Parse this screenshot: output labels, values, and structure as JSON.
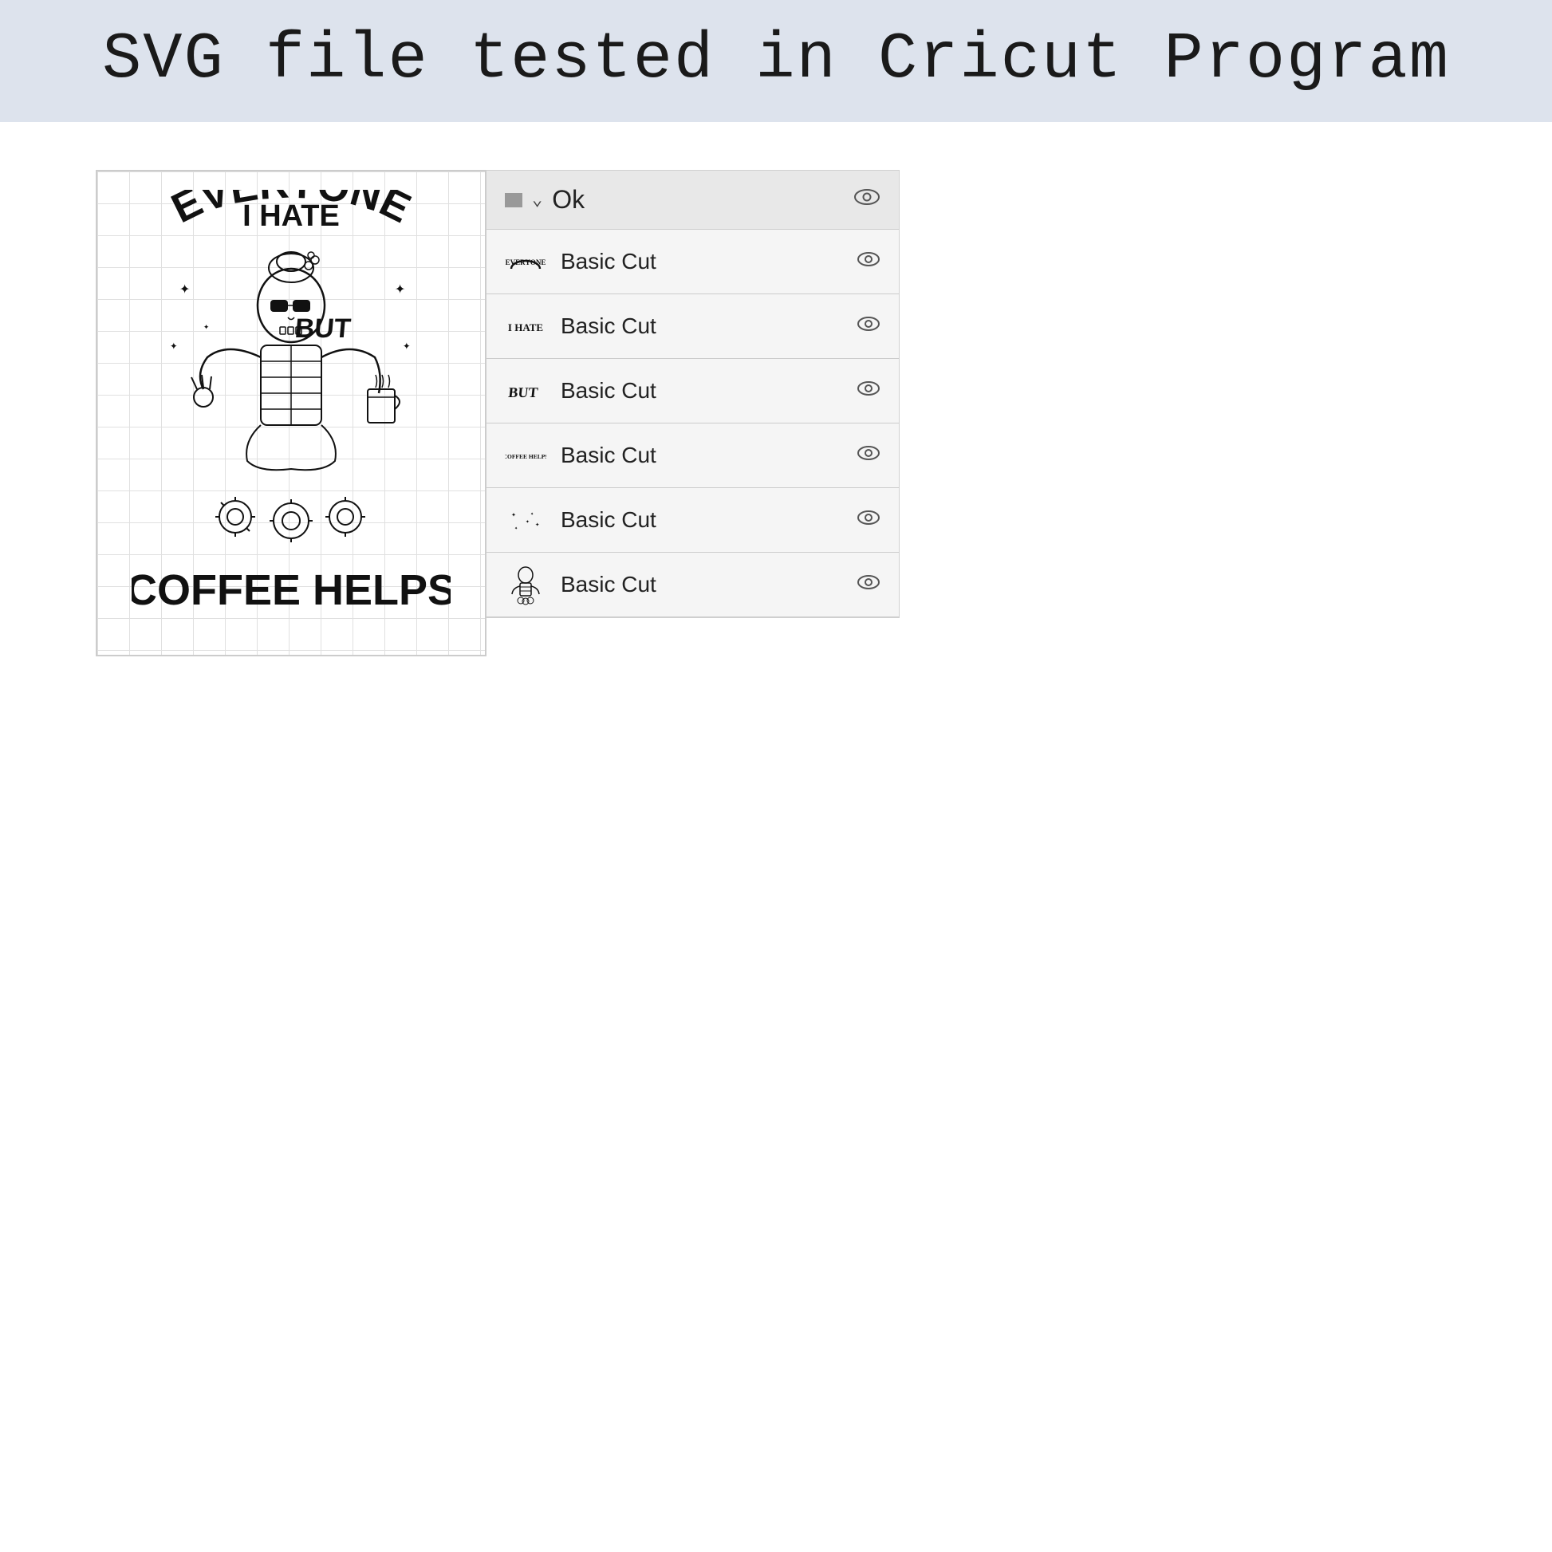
{
  "header": {
    "title": "SVG file tested in Cricut Program",
    "background_color": "#dde3ed"
  },
  "layers_panel": {
    "header_label": "Ok",
    "rows": [
      {
        "id": 1,
        "label": "Basic Cut",
        "thumb_type": "everyone"
      },
      {
        "id": 2,
        "label": "Basic Cut",
        "thumb_type": "ihate"
      },
      {
        "id": 3,
        "label": "Basic Cut",
        "thumb_type": "but"
      },
      {
        "id": 4,
        "label": "Basic Cut",
        "thumb_type": "coffeehelps"
      },
      {
        "id": 5,
        "label": "Basic Cut",
        "thumb_type": "dots"
      },
      {
        "id": 6,
        "label": "Basic Cut",
        "thumb_type": "skeleton"
      }
    ]
  },
  "svg_preview": {
    "alt": "I Hate Everyone But Coffee Helps skeleton SVG design"
  }
}
